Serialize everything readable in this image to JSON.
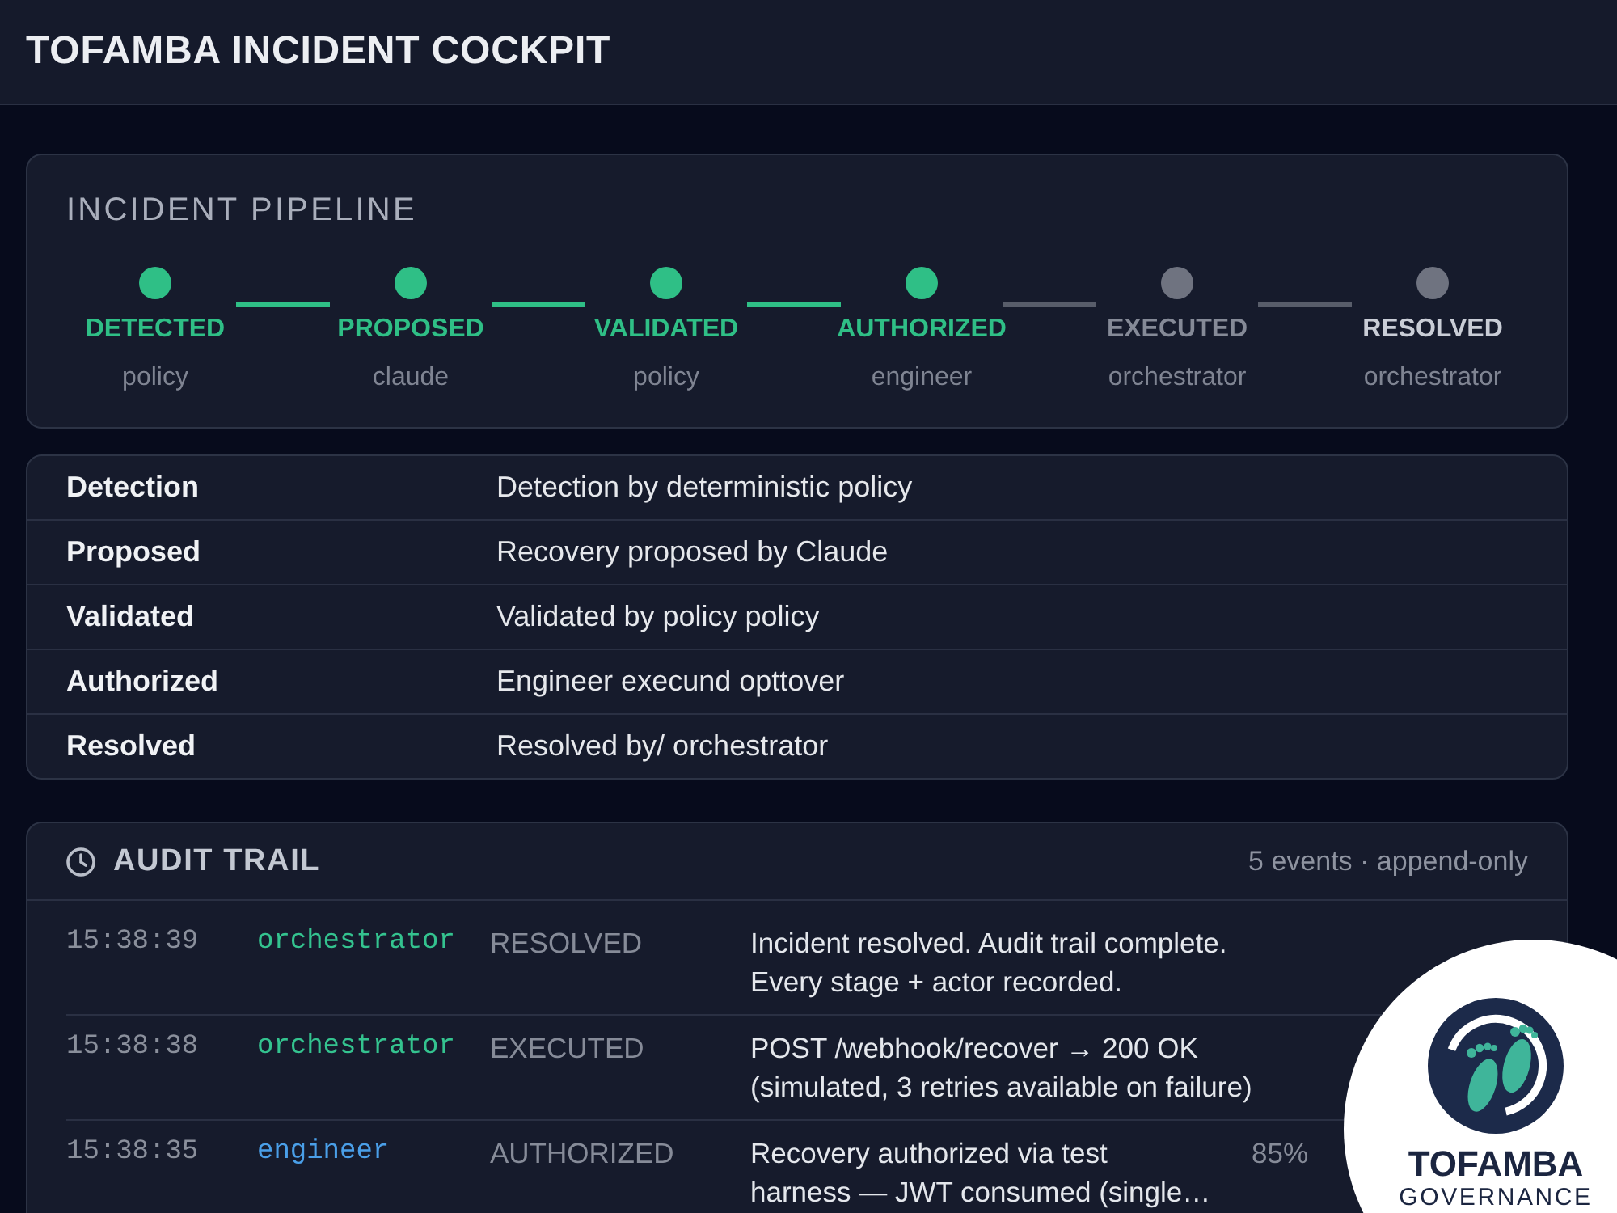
{
  "header": {
    "title": "TOFAMBA INCIDENT COCKPIT"
  },
  "pipeline": {
    "title": "INCIDENT PIPELINE",
    "steps": [
      {
        "label": "DETECTED",
        "actor": "policy",
        "done": true,
        "current": false
      },
      {
        "label": "PROPOSED",
        "actor": "claude",
        "done": true,
        "current": false
      },
      {
        "label": "VALIDATED",
        "actor": "policy",
        "done": true,
        "current": false
      },
      {
        "label": "AUTHORIZED",
        "actor": "engineer",
        "done": true,
        "current": false
      },
      {
        "label": "EXECUTED",
        "actor": "orchestrator",
        "done": false,
        "current": false
      },
      {
        "label": "RESOLVED",
        "actor": "orchestrator",
        "done": false,
        "current": true
      }
    ]
  },
  "details": {
    "rows": [
      {
        "label": "Detection",
        "value": "Detection by deterministic policy"
      },
      {
        "label": "Proposed",
        "value": "Recovery proposed by Claude"
      },
      {
        "label": "Validated",
        "value": "Validated by policy policy"
      },
      {
        "label": "Authorized",
        "value": "Engineer execund opttover"
      },
      {
        "label": "Resolved",
        "value": "Resolved by/ orchestrator"
      }
    ]
  },
  "audit": {
    "title": "AUDIT TRAIL",
    "summary": "5 events · append-only",
    "events": [
      {
        "time": "15:38:39",
        "actor": "orchestrator",
        "color": "#34c38f",
        "stage": "RESOLVED",
        "message": "Incident resolved. Audit trail complete.\nEvery stage + actor recorded."
      },
      {
        "time": "15:38:38",
        "actor": "orchestrator",
        "color": "#34c38f",
        "stage": "EXECUTED",
        "message": "POST /webhook/recover → 200 OK\n(simulated, 3 retries available on failure)"
      },
      {
        "time": "15:38:35",
        "actor": "engineer",
        "color": "#4a9fe8",
        "stage": "AUTHORIZED",
        "message": "Recovery authorized via test\nharness — JWT consumed (single…",
        "percent": "85%"
      }
    ]
  },
  "badge": {
    "name": "TOFAMBA",
    "tagline": "GOVERNANCE"
  }
}
